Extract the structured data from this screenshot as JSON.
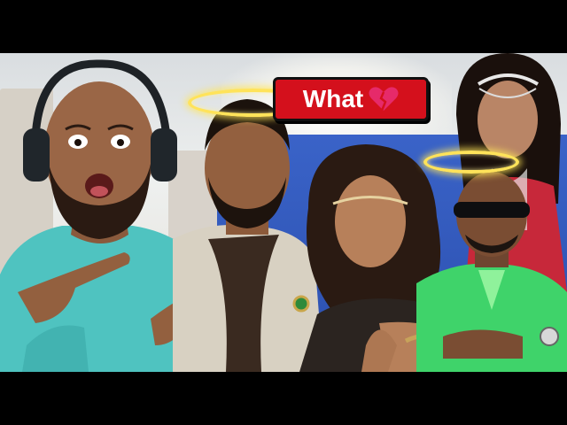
{
  "overlay": {
    "caption_text": "What",
    "caption_emoji_icon": "broken-heart-icon"
  },
  "colors": {
    "caption_background": "#d4101c",
    "halo": "#ffe35a",
    "letterbox": "#000000"
  }
}
